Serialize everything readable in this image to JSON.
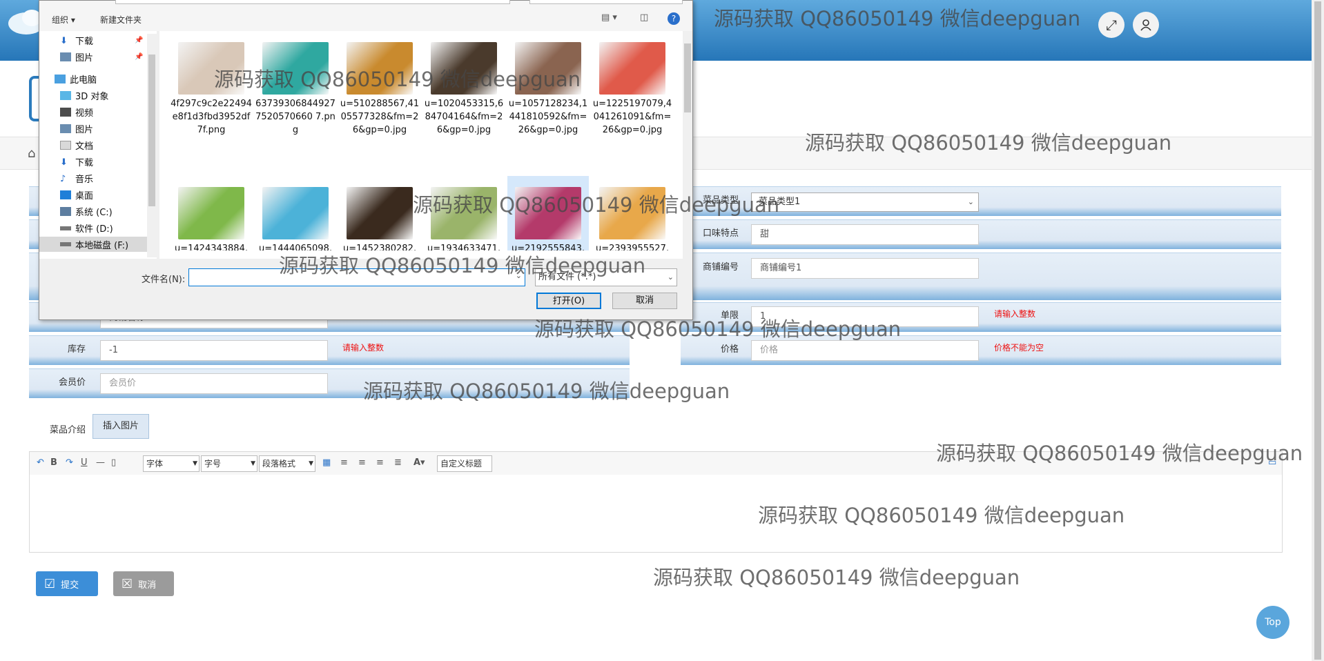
{
  "header": {
    "fullscreen_icon": "expand-icon",
    "user_icon": "user-icon"
  },
  "form": {
    "category": {
      "label": "菜品类型",
      "value": "菜品类型1"
    },
    "taste": {
      "label": "口味特点",
      "value": "甜"
    },
    "shop_no": {
      "label": "商铺编号",
      "value": "商铺编号1"
    },
    "shop_name": {
      "value": "商铺名称1"
    },
    "limit": {
      "label": "单限",
      "value": "1",
      "error": "请输入整数"
    },
    "stock": {
      "label": "库存",
      "value": "-1",
      "error": "请输入整数"
    },
    "price": {
      "label": "价格",
      "placeholder": "价格",
      "error": "价格不能为空"
    },
    "member_price": {
      "label": "会员价",
      "placeholder": "会员价"
    },
    "intro": {
      "label": "菜品介绍",
      "insert_image": "插入图片"
    }
  },
  "editor": {
    "font": "字体",
    "size": "字号",
    "paragraph": "段落格式",
    "custom_title": "自定义标题"
  },
  "actions": {
    "submit": "提交",
    "cancel": "取消"
  },
  "top_button": "Top",
  "dialog": {
    "organize": "组织 ▾",
    "new_folder": "新建文件夹",
    "nav": {
      "downloads_quick": "下载",
      "pictures_quick": "图片",
      "this_pc": "此电脑",
      "objects3d": "3D 对象",
      "videos": "视频",
      "pictures": "图片",
      "documents": "文档",
      "downloads": "下载",
      "music": "音乐",
      "desktop": "桌面",
      "drive_c": "系统 (C:)",
      "drive_d": "软件 (D:)",
      "drive_f": "本地磁盘 (F:)"
    },
    "files": [
      {
        "name": "4f297c9c2e22494e8f1d3fbd3952df7f.png",
        "color": "#d9c8b8"
      },
      {
        "name": "637393068449277520570660 7.png",
        "color": "#2fa8a0"
      },
      {
        "name": "u=510288567,4105577328&fm=26&gp=0.jpg",
        "color": "#c98a2e"
      },
      {
        "name": "u=1020453315,684704164&fm=26&gp=0.jpg",
        "color": "#4a3a2c"
      },
      {
        "name": "u=1057128234,1441810592&fm=26&gp=0.jpg",
        "color": "#8a6450"
      },
      {
        "name": "u=1225197079,4041261091&fm=26&gp=0.jpg",
        "color": "#e05a4a"
      },
      {
        "name": "u=1424343884,",
        "color": "#7fb84a"
      },
      {
        "name": "u=1444065098,",
        "color": "#4cb2d8"
      },
      {
        "name": "u=1452380282,",
        "color": "#3a2a1e"
      },
      {
        "name": "u=1934633471,",
        "color": "#9ab46a"
      },
      {
        "name": "u=2192555843,",
        "color": "#b43a6a"
      },
      {
        "name": "u=2393955527,",
        "color": "#e8a84a"
      }
    ],
    "filename_label": "文件名(N):",
    "filename_value": "",
    "filetype": "所有文件 (*.*)",
    "open": "打开(O)",
    "cancel": "取消"
  },
  "watermark": "源码获取 QQ86050149 微信deepguan"
}
